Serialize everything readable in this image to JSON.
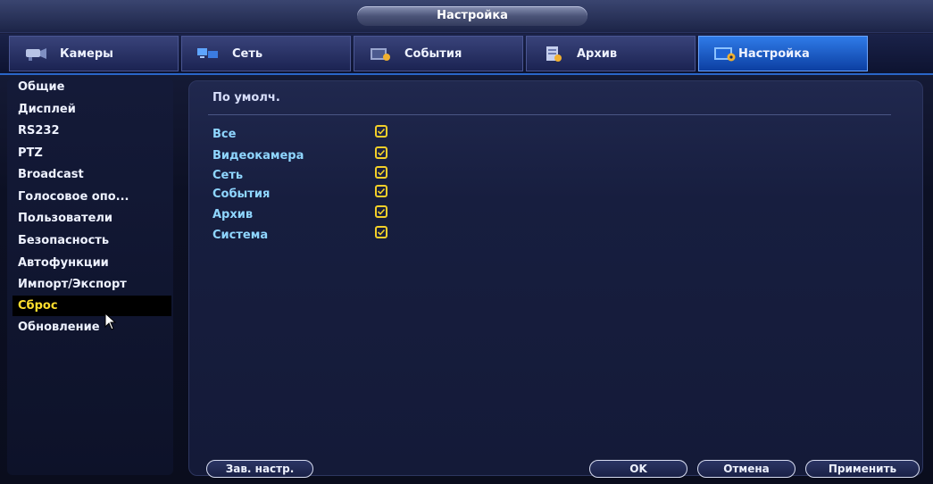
{
  "window": {
    "title": "Настройка"
  },
  "tabs": [
    {
      "label": "Камеры",
      "icon": "camera-icon"
    },
    {
      "label": "Сеть",
      "icon": "network-icon"
    },
    {
      "label": "События",
      "icon": "events-icon"
    },
    {
      "label": "Архив",
      "icon": "archive-icon"
    },
    {
      "label": "Настройка",
      "icon": "settings-icon",
      "active": true
    }
  ],
  "sidebar": {
    "items": [
      {
        "label": "Общие"
      },
      {
        "label": "Дисплей"
      },
      {
        "label": "RS232"
      },
      {
        "label": "PTZ"
      },
      {
        "label": "Broadcast"
      },
      {
        "label": "Голосовое опо..."
      },
      {
        "label": "Пользователи"
      },
      {
        "label": "Безопасность"
      },
      {
        "label": "Автофункции"
      },
      {
        "label": "Импорт/Экспорт"
      },
      {
        "label": "Сброс",
        "selected": true
      },
      {
        "label": "Обновление"
      }
    ]
  },
  "main": {
    "section_title": "По умолч.",
    "options": [
      {
        "label": "Все",
        "checked": true
      },
      {
        "label": "Видеокамера",
        "checked": true
      },
      {
        "label": "Сеть",
        "checked": true
      },
      {
        "label": "События",
        "checked": true
      },
      {
        "label": "Архив",
        "checked": true
      },
      {
        "label": "Система",
        "checked": true
      }
    ]
  },
  "buttons": {
    "save_label": "Зав. настр.",
    "ok_label": "OK",
    "cancel_label": "Отмена",
    "apply_label": "Применить"
  },
  "colors": {
    "accent_tab": "#1e5fd0",
    "checkbox_border": "#f2cf2a",
    "option_text": "#8fd6ff",
    "selected_text": "#ffde2e"
  }
}
